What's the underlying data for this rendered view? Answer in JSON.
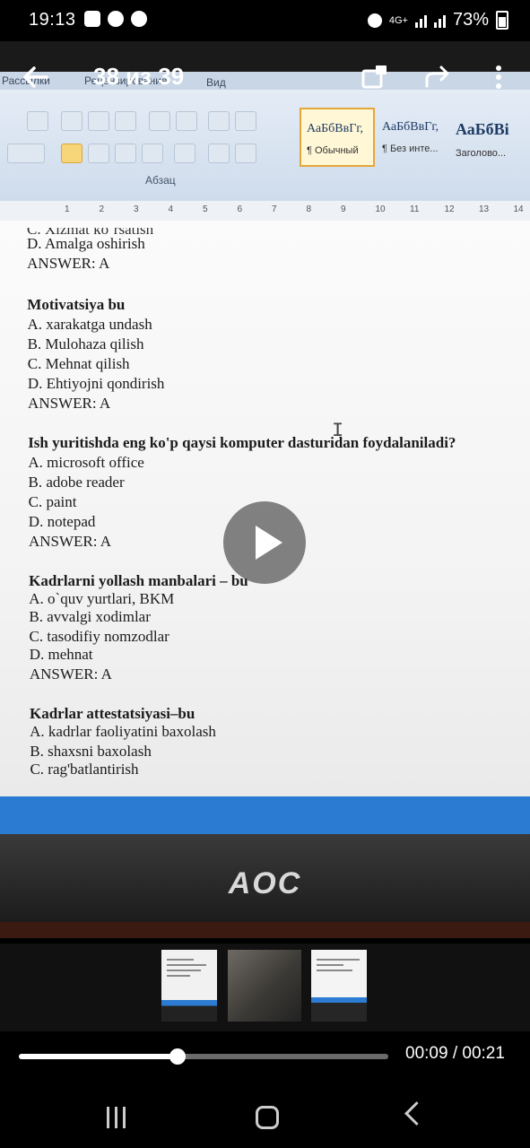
{
  "status_bar": {
    "time": "19:13",
    "network": "4G+",
    "battery": "73%",
    "icons": [
      "gallery-icon",
      "messenger-icon",
      "shazam-icon",
      "alarm-icon",
      "signal-icon",
      "battery-icon"
    ]
  },
  "viewer": {
    "counter": "38 из 39",
    "back_icon": "arrow-left-icon",
    "share_icon": "share-icon",
    "forward_icon": "forward-icon",
    "more_icon": "more-vertical-icon"
  },
  "word_ribbon": {
    "tabs": [
      "Рассылки",
      "Рецензирование",
      "Вид"
    ],
    "group_label": "Абзац",
    "styles": [
      {
        "sample": "АаБбВвГг,",
        "name": "¶ Обычный"
      },
      {
        "sample": "АаБбВвГг,",
        "name": "¶ Без инте..."
      },
      {
        "sample": "АаБбВі",
        "name": "Заголово..."
      }
    ],
    "ruler": [
      "1",
      "2",
      "3",
      "4",
      "5",
      "6",
      "7",
      "8",
      "9",
      "10",
      "11",
      "12",
      "13",
      "14"
    ]
  },
  "document": {
    "cut_line": "C. Xizmat ko`rsatish",
    "lines": [
      {
        "text": "D. Amalga oshirish",
        "bold": false
      },
      {
        "text": "ANSWER: A",
        "bold": false
      },
      {
        "text": "Motivatsiya bu",
        "bold": true
      },
      {
        "text": "A. xarakatga undash",
        "bold": false
      },
      {
        "text": "B. Mulohaza qilish",
        "bold": false
      },
      {
        "text": "C. Mehnat qilish",
        "bold": false
      },
      {
        "text": "D. Ehtiyojni qondirish",
        "bold": false
      },
      {
        "text": "ANSWER: A",
        "bold": false
      },
      {
        "text": "Ish yuritishda eng ko'p qaysi komputer dasturidan foydalaniladi?",
        "bold": true
      },
      {
        "text": "A. microsoft office",
        "bold": false
      },
      {
        "text": "B. adobe reader",
        "bold": false
      },
      {
        "text": "C. paint",
        "bold": false
      },
      {
        "text": "D. notepad",
        "bold": false
      },
      {
        "text": "ANSWER: A",
        "bold": false
      },
      {
        "text": "Kadrlarni yollash manbalari – bu",
        "bold": true
      },
      {
        "text": "A. o`quv yurtlari, BKM",
        "bold": false
      },
      {
        "text": "B. avvalgi xodimlar",
        "bold": false
      },
      {
        "text": "C. tasodifiy nomzodlar",
        "bold": false
      },
      {
        "text": "D. mehnat",
        "bold": false
      },
      {
        "text": "ANSWER: A",
        "bold": false
      },
      {
        "text": "Kadrlar attestatsiyasi–bu",
        "bold": true
      },
      {
        "text": "A. kadrlar faoliyatini baxolash",
        "bold": false
      },
      {
        "text": "B. shaxsni baxolash",
        "bold": false
      },
      {
        "text": "C. rag'batlantirish",
        "bold": false
      }
    ]
  },
  "monitor": {
    "brand": "AOC"
  },
  "thumbnails": [
    {
      "name": "thumb-document-photo"
    },
    {
      "name": "thumb-hand-photo"
    },
    {
      "name": "thumb-monitor-photo"
    }
  ],
  "player": {
    "time": "00:09 / 00:21",
    "progress": 0.4286
  },
  "nav": {
    "recent": "recent-apps-icon",
    "home": "home-icon",
    "back": "back-icon"
  }
}
